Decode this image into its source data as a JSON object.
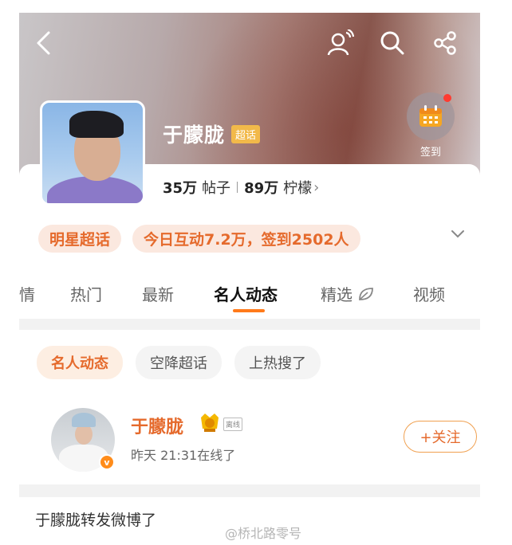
{
  "header": {
    "back_icon": "back-arrow-icon",
    "super_icon": "super-topic-people-icon",
    "search_icon": "search-icon",
    "share_icon": "share-icon"
  },
  "profile": {
    "name": "于朦胧",
    "badge": "超话",
    "checkin_label": "签到",
    "posts_count": "35万",
    "posts_label": "帖子",
    "followers_count": "89万",
    "followers_label": "柠檬",
    "followers_arrow": "›"
  },
  "tags": {
    "category": "明星超话",
    "activity": "今日互动7.2万，签到2502人"
  },
  "tabs": [
    {
      "label": "情"
    },
    {
      "label": "热门"
    },
    {
      "label": "最新"
    },
    {
      "label": "名人动态"
    },
    {
      "label": "精选"
    },
    {
      "label": "视频"
    }
  ],
  "subtabs": [
    {
      "label": "名人动态"
    },
    {
      "label": "空降超话"
    },
    {
      "label": "上热搜了"
    }
  ],
  "post": {
    "author": "于朦胧",
    "online_tag": "离线",
    "verified": "v",
    "time": "昨天 21:31在线了",
    "follow_label": "+关注",
    "text": "于朦胧转发微博了"
  },
  "watermark": "@桥北路零号",
  "colors": {
    "accent": "#e56a2c",
    "tab_underline": "#ff7a1a"
  }
}
